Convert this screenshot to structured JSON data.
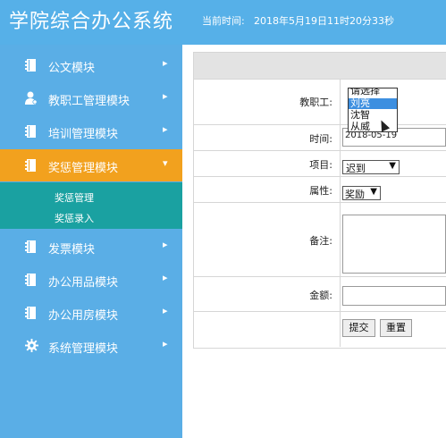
{
  "header": {
    "title": "学院综合办公系统",
    "time_label": "当前时间:",
    "time_value": "2018年5月19日11时20分33秒",
    "bg_color": "#56b0e8"
  },
  "sidebar": {
    "bg_color": "#5aaee6",
    "active_color": "#f2a11e",
    "submenu_color": "#1aa1a1",
    "items": [
      {
        "label": "公文模块",
        "icon": "document-icon",
        "chevron": "▸"
      },
      {
        "label": "教职工管理模块",
        "icon": "user-gear-icon",
        "chevron": "▸"
      },
      {
        "label": "培训管理模块",
        "icon": "document-icon",
        "chevron": "▸"
      },
      {
        "label": "奖惩管理模块",
        "icon": "document-icon",
        "chevron": "▾",
        "active": true
      },
      {
        "label": "发票模块",
        "icon": "document-icon",
        "chevron": "▸"
      },
      {
        "label": "办公用品模块",
        "icon": "document-icon",
        "chevron": "▸"
      },
      {
        "label": "办公用房模块",
        "icon": "document-icon",
        "chevron": "▸"
      },
      {
        "label": "系统管理模块",
        "icon": "gear-icon",
        "chevron": "▸"
      }
    ],
    "submenu": [
      "奖惩管理",
      "奖惩录入"
    ]
  },
  "form": {
    "staff_label": "教职工:",
    "staff_options": [
      "请选择",
      "刘亮",
      "沈智",
      "从威"
    ],
    "staff_selected": "刘亮",
    "time_label": "时间:",
    "time_value": "2018-05-19",
    "item_label": "项目:",
    "item_value": "迟到",
    "attr_label": "属性:",
    "attr_value": "奖励",
    "note_label": "备注:",
    "amount_label": "金额:",
    "submit_label": "提交",
    "reset_label": "重置"
  }
}
